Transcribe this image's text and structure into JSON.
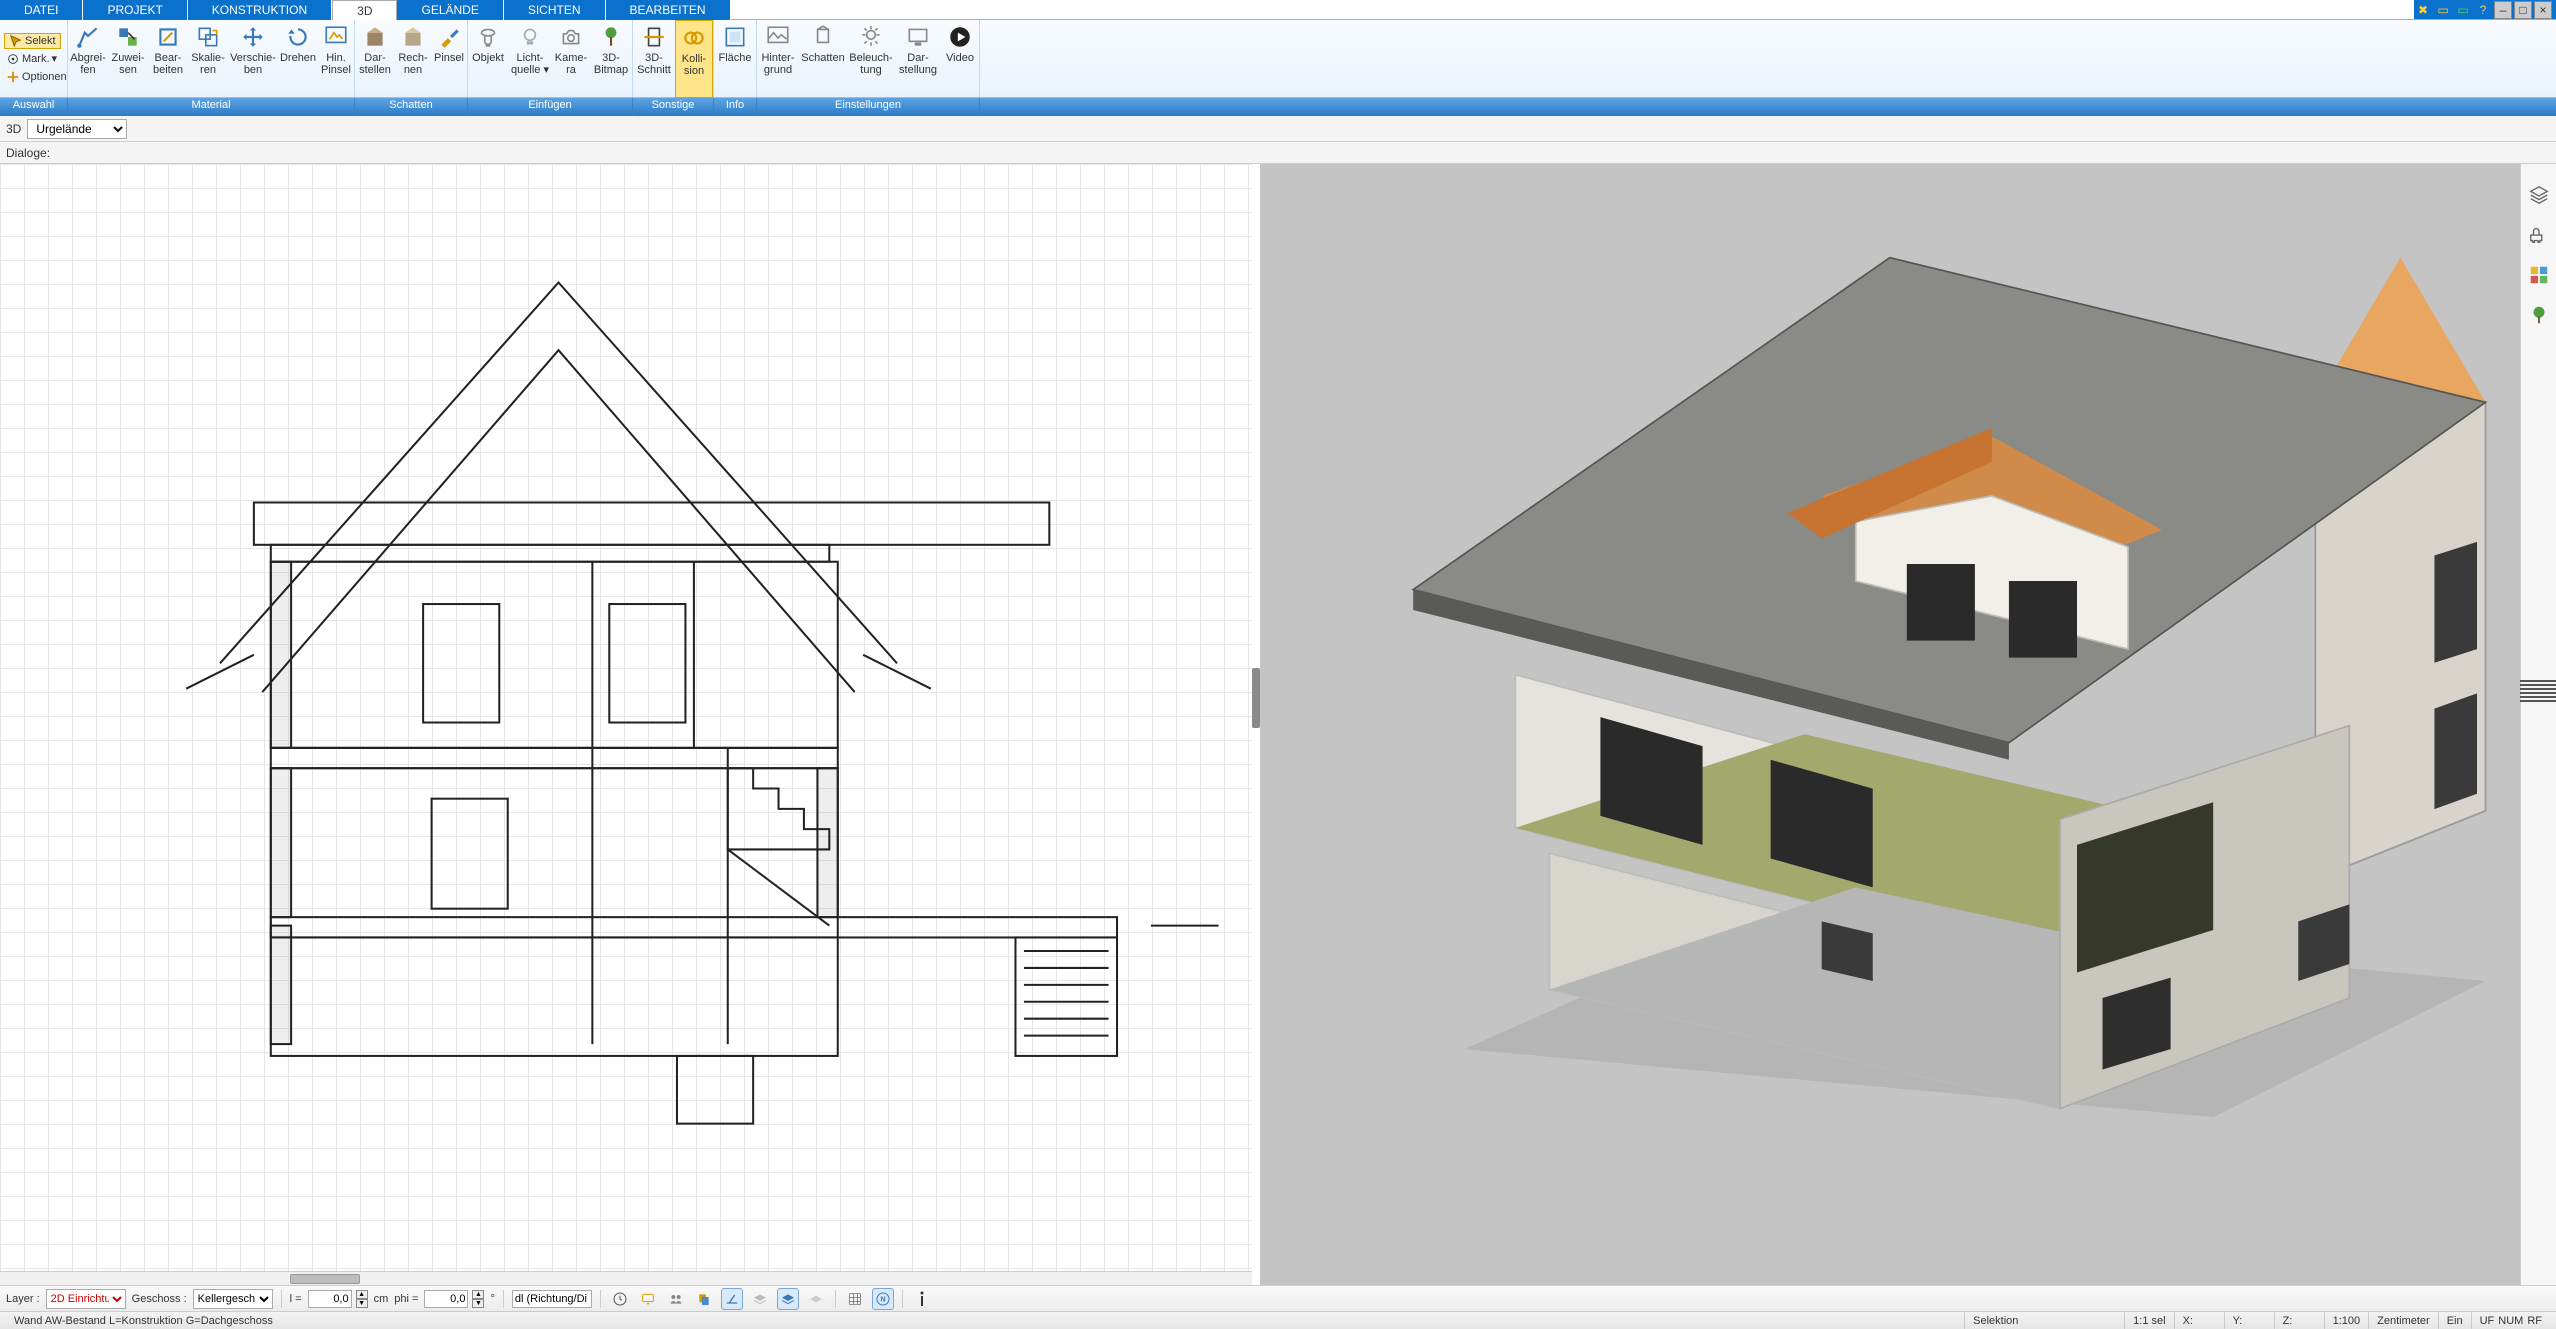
{
  "menu": {
    "tabs": [
      "DATEI",
      "PROJEKT",
      "KONSTRUKTION",
      "3D",
      "GELÄNDE",
      "SICHTEN",
      "BEARBEITEN"
    ],
    "active_index": 3
  },
  "selection_panel": {
    "select": "Selekt",
    "mark": "Mark.",
    "options": "Optionen",
    "group_label": "Auswahl"
  },
  "ribbon": {
    "material": {
      "label": "Material",
      "buttons": [
        {
          "id": "abgreifen",
          "l1": "Abgrei-",
          "l2": "fen"
        },
        {
          "id": "zuweisen",
          "l1": "Zuwei-",
          "l2": "sen"
        },
        {
          "id": "bearbeiten",
          "l1": "Bear-",
          "l2": "beiten"
        },
        {
          "id": "skalieren",
          "l1": "Skalie-",
          "l2": "ren"
        },
        {
          "id": "verschieben",
          "l1": "Verschie-",
          "l2": "ben"
        },
        {
          "id": "drehen",
          "l1": "Drehen",
          "l2": ""
        },
        {
          "id": "hinpinsel",
          "l1": "Hin.",
          "l2": "Pinsel"
        }
      ]
    },
    "schatten": {
      "label": "Schatten",
      "buttons": [
        {
          "id": "darstellen",
          "l1": "Dar-",
          "l2": "stellen"
        },
        {
          "id": "rechnen",
          "l1": "Rech-",
          "l2": "nen"
        },
        {
          "id": "pinsel",
          "l1": "Pinsel",
          "l2": ""
        }
      ]
    },
    "einfuegen": {
      "label": "Einfügen",
      "buttons": [
        {
          "id": "objekt",
          "l1": "Objekt",
          "l2": ""
        },
        {
          "id": "lichtquelle",
          "l1": "Licht-",
          "l2": "quelle ▾"
        },
        {
          "id": "kamera",
          "l1": "Kame-",
          "l2": "ra"
        },
        {
          "id": "3dbitmap",
          "l1": "3D-",
          "l2": "Bitmap"
        }
      ]
    },
    "sonstige": {
      "label": "Sonstige",
      "buttons": [
        {
          "id": "3dschnitt",
          "l1": "3D-",
          "l2": "Schnitt"
        },
        {
          "id": "kollision",
          "l1": "Kolli-",
          "l2": "sion",
          "highlight": true
        }
      ]
    },
    "info": {
      "label": "Info",
      "buttons": [
        {
          "id": "flaeche",
          "l1": "Fläche",
          "l2": ""
        }
      ]
    },
    "einstellungen": {
      "label": "Einstellungen",
      "buttons": [
        {
          "id": "hintergrund",
          "l1": "Hinter-",
          "l2": "grund"
        },
        {
          "id": "schatten2",
          "l1": "Schatten",
          "l2": ""
        },
        {
          "id": "beleuchtung",
          "l1": "Beleuch-",
          "l2": "tung"
        },
        {
          "id": "darstellung",
          "l1": "Dar-",
          "l2": "stellung"
        },
        {
          "id": "video",
          "l1": "Video",
          "l2": ""
        }
      ]
    }
  },
  "subbar": {
    "mode_label": "3D",
    "terrain_select": "Urgelände",
    "dialoge_label": "Dialoge:"
  },
  "bottombar": {
    "layer_label": "Layer :",
    "layer_value": "2D Einrichtu",
    "floor_label": "Geschoss :",
    "floor_value": "Kellergesch",
    "l_label": "l =",
    "l_value": "0,0",
    "l_unit": "cm",
    "phi_label": "phi =",
    "phi_value": "0,0",
    "phi_unit": "°",
    "dl_label": "dl (Richtung/Di"
  },
  "statusbar": {
    "left": "Wand AW-Bestand L=Konstruktion G=Dachgeschoss",
    "selection": "Selektion",
    "sel_ratio": "1:1 sel",
    "x": "X:",
    "y": "Y:",
    "z": "Z:",
    "scale": "1:100",
    "unit": "Zentimeter",
    "ein": "Ein",
    "uf": "UF",
    "num": "NUM",
    "rf": "RF"
  },
  "icons": {
    "layers": "layers",
    "chair": "chair",
    "palette": "palette",
    "tree": "tree"
  }
}
